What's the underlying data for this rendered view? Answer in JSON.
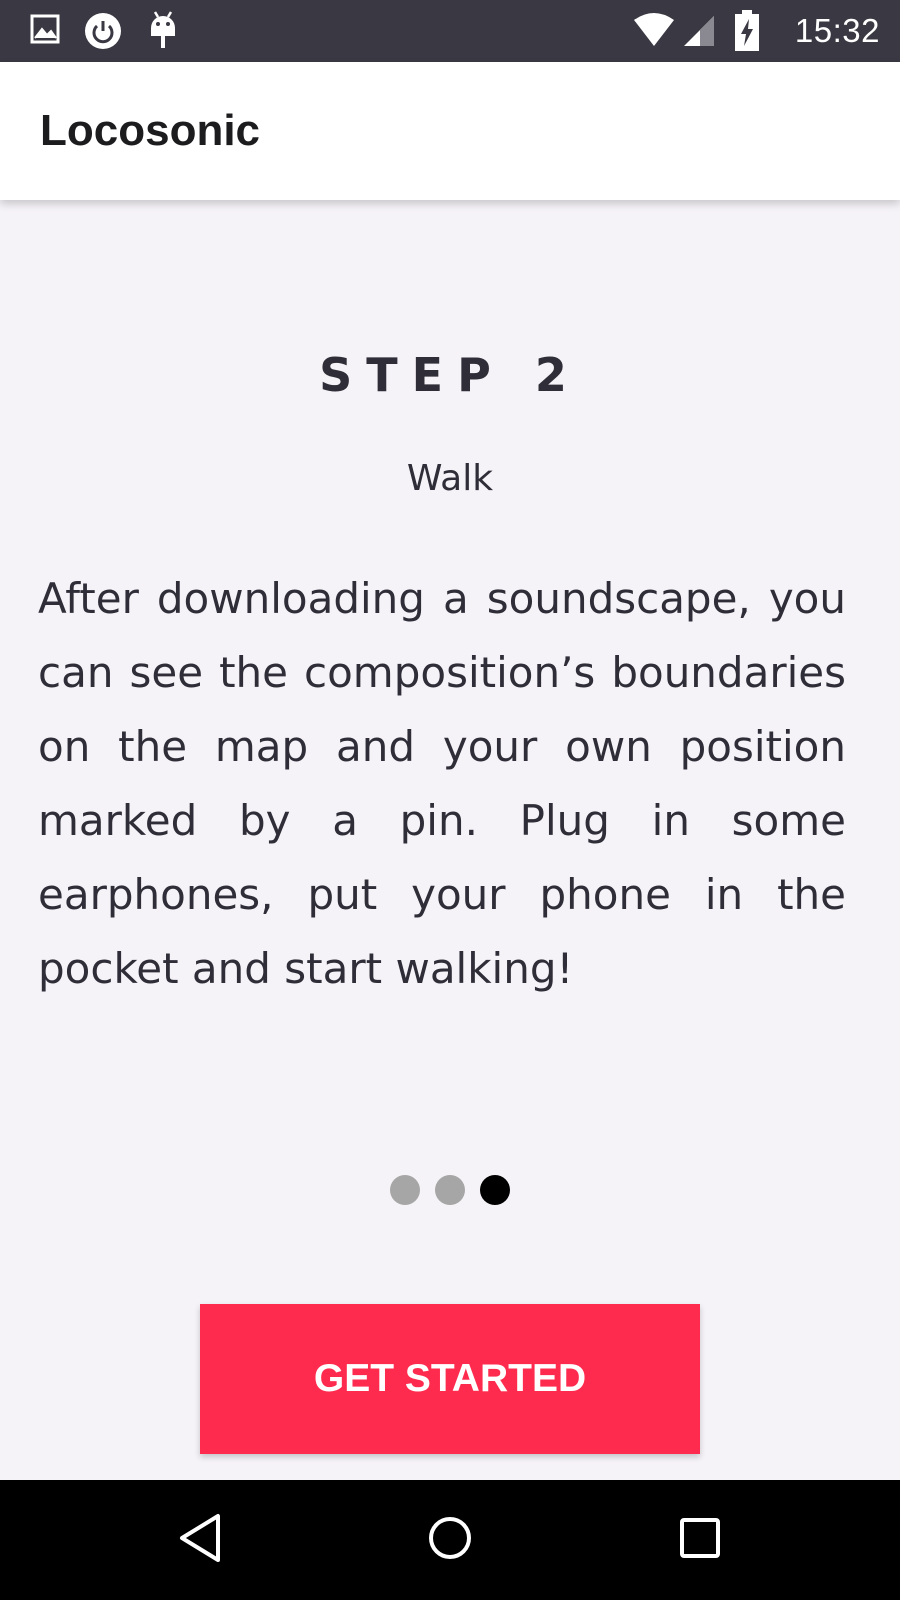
{
  "status_bar": {
    "time": "15:32",
    "icons_left": [
      "image-icon",
      "power-icon",
      "android-debug-icon"
    ],
    "icons_right": [
      "wifi-icon",
      "signal-icon",
      "battery-charging-icon"
    ]
  },
  "app_bar": {
    "title": "Locosonic"
  },
  "onboarding": {
    "step_label": "STEP 2",
    "step_name": "Walk",
    "body": "After downloading a soundscape, you can see the composition’s boundaries on the map and your own position marked by a pin. Plug in some earphones, put your phone in the pocket and start walking!",
    "page_indicator": {
      "total": 3,
      "current": 3
    },
    "cta_label": "GET STARTED"
  },
  "colors": {
    "status_bar": "#3a3842",
    "background": "#f6f3f8",
    "accent": "#ff2b4e",
    "dot_inactive": "#a6a6a6",
    "dot_active": "#000000"
  },
  "nav_bar": {
    "buttons": [
      "back-icon",
      "home-icon",
      "recents-icon"
    ]
  }
}
